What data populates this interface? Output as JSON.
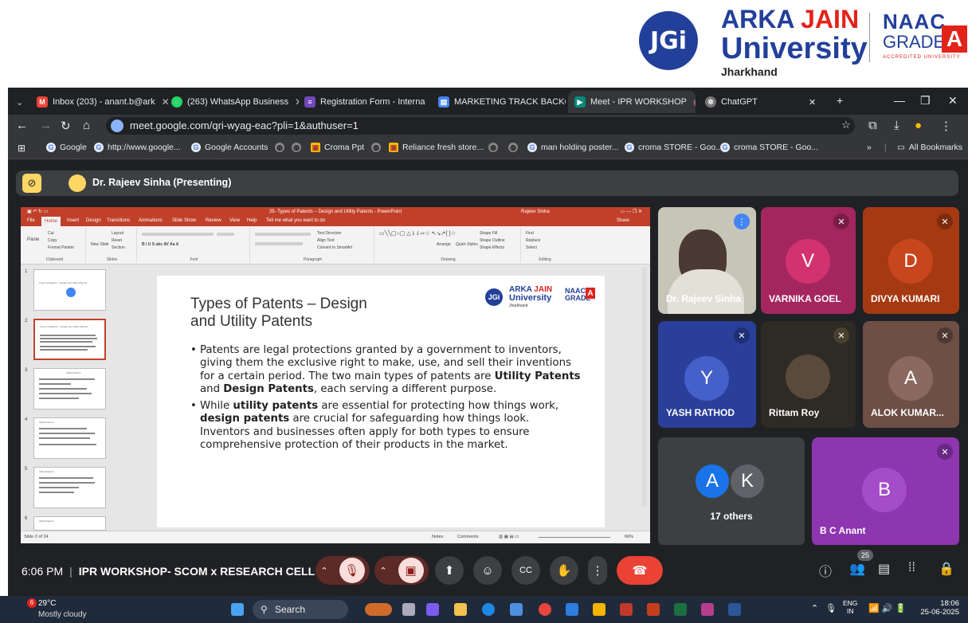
{
  "banner": {
    "jgi": "JGi",
    "uni_line1_a": "ARKA ",
    "uni_line1_b": "JAIN",
    "uni_line2": "University",
    "uni_line3": "Jharkhand",
    "naac_line1": "NAAC",
    "naac_line2": "GRADE",
    "naac_grade": "A",
    "naac_line3": "ACCREDITED UNIVERSITY"
  },
  "tabs": [
    {
      "label": "Inbox (203) - anant.b@ark",
      "icon": "gmail-icon",
      "color": "#ea4335"
    },
    {
      "label": "(263) WhatsApp Business",
      "icon": "whatsapp-icon",
      "color": "#25d366"
    },
    {
      "label": "Registration Form - Interna",
      "icon": "forms-icon",
      "color": "#7248b9"
    },
    {
      "label": "MARKETING TRACK BACKG",
      "icon": "doc-icon",
      "color": "#4285f4"
    },
    {
      "label": "Meet - IPR WORKSHOP",
      "icon": "meet-icon",
      "color": "#00897b",
      "active": true
    },
    {
      "label": "ChatGPT",
      "icon": "chatgpt-icon",
      "color": "#777777"
    }
  ],
  "address": {
    "url": "meet.google.com/qri-wyag-eac?pli=1&authuser=1"
  },
  "bookmarks": [
    "Google",
    "http://www.google...",
    "Google Accounts",
    "Croma Ppt",
    "Reliance fresh store...",
    "man holding poster...",
    "croma STORE - Goo...",
    "croma STORE - Goo..."
  ],
  "bookmarks_all": "All Bookmarks",
  "presenting": {
    "label": "Dr. Rajeev Sinha (Presenting)"
  },
  "ppt": {
    "window_title": "25- Types of Patents – Design and Utility Patents - PowerPoint",
    "user": "Rajeev Sinha",
    "menu": [
      "File",
      "Home",
      "Insert",
      "Design",
      "Transitions",
      "Animations",
      "Slide Show",
      "Review",
      "View",
      "Help",
      "Tell me what you want to do"
    ],
    "share": "Share",
    "groups": [
      "Clipboard",
      "Slides",
      "Font",
      "Paragraph",
      "Drawing",
      "Editing"
    ],
    "ribbon_items": {
      "paste": "Paste",
      "cut": "Cut",
      "copy": "Copy",
      "format_painter": "Format Painter",
      "new_slide": "New Slide",
      "layout": "Layout",
      "reset": "Reset",
      "section": "Section",
      "text_direction": "Text Direction",
      "align_text": "Align Text",
      "convert_smartart": "Convert to SmartArt",
      "arrange": "Arrange",
      "quick_styles": "Quick Styles",
      "shape_fill": "Shape Fill",
      "shape_outline": "Shape Outline",
      "shape_effects": "Shape Effects",
      "find": "Find",
      "replace": "Replace",
      "select": "Select"
    },
    "thumb_numbers": [
      "1",
      "2",
      "3",
      "4",
      "5",
      "6"
    ],
    "thumb_titles": [
      "Types of Patents – Design and Utility Patents",
      "Types of Patents – Design and Utility Patents",
      "Utility Patents",
      "Utility Patents",
      "Utility Patents",
      "Utility Patents"
    ],
    "slide": {
      "title": "Types of Patents – Design\nand Utility Patents",
      "logo_line1a": "ARKA ",
      "logo_line1b": "JAIN",
      "logo_line2": "University",
      "logo_line3": "Jharkhand",
      "logo_circle": "JGi",
      "naac": "NAAC\nGRADE",
      "naac_grade": "A",
      "bullets": [
        [
          {
            "t": "Patents are legal protections granted by a government to inventors, giving them the exclusive right to make, use, and sell their inventions for a certain period. The two main types of patents are "
          },
          {
            "t": "Utility Patents",
            "b": true
          },
          {
            "t": " and "
          },
          {
            "t": "Design Patents",
            "b": true
          },
          {
            "t": ", each serving a different purpose."
          }
        ],
        [
          {
            "t": "While "
          },
          {
            "t": "utility patents",
            "b": true
          },
          {
            "t": " are essential for protecting how things work, "
          },
          {
            "t": "design patents",
            "b": true
          },
          {
            "t": " are crucial for safeguarding how things look. Inventors and businesses often apply for both types to ensure comprehensive protection of their products in the market."
          }
        ]
      ]
    },
    "status_slide": "Slide 2 of 24",
    "status_notes": "Notes",
    "status_comments": "Comments",
    "status_zoom": "66%"
  },
  "participants": [
    {
      "name": "Dr. Rajeev Sinha",
      "kind": "video",
      "bg": "#c7c4b8"
    },
    {
      "name": "VARNIKA GOEL",
      "initial": "V",
      "bg": "#a4265e",
      "avbg": "#d2336f"
    },
    {
      "name": "DIVYA KUMARI",
      "initial": "D",
      "bg": "#a53a12",
      "avbg": "#c8461d"
    },
    {
      "name": "YASH RATHOD",
      "initial": "Y",
      "bg": "#2a3f9a",
      "avbg": "#4560c9"
    },
    {
      "name": "Rittam Roy",
      "kind": "photo",
      "bg": "#2e2a24"
    },
    {
      "name": "ALOK KUMAR...",
      "initial": "A",
      "bg": "#6d4f45",
      "avbg": "#8a6a60"
    },
    {
      "name": "17 others",
      "initials": [
        "A",
        "K"
      ],
      "bg": "#3c4043"
    },
    {
      "name": "B C Anant",
      "initial": "B",
      "bg": "#8e35b0",
      "avbg": "#a54cc8"
    }
  ],
  "meeting": {
    "time": "6:06 PM",
    "separator": "|",
    "title": "IPR WORKSHOP- SCOM x RESEARCH CELL",
    "people_count": "25"
  },
  "taskbar": {
    "temp": "29°C",
    "weather": "Mostly cloudy",
    "search": "Search",
    "lang1": "ENG",
    "lang2": "IN",
    "time": "18:06",
    "date": "25-06-2025",
    "badge": "6"
  }
}
